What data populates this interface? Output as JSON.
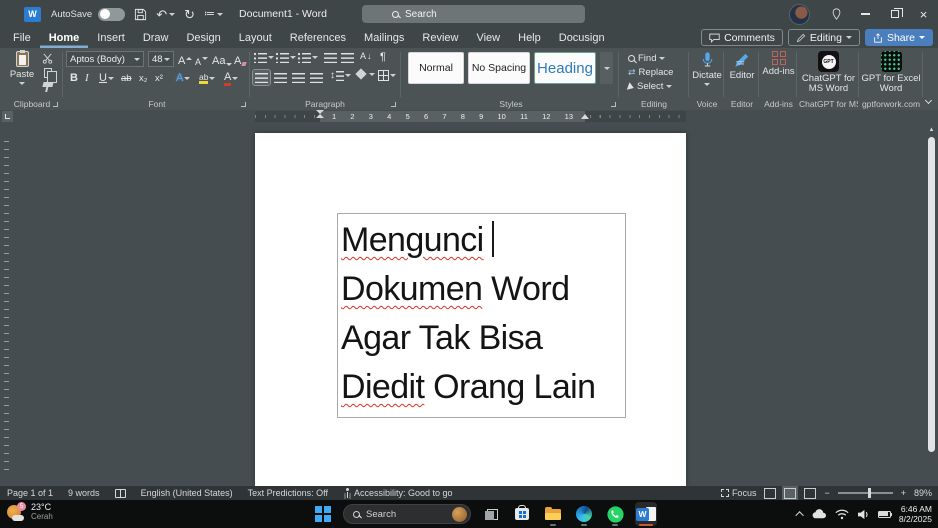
{
  "titlebar": {
    "autosave_label": "AutoSave",
    "autosave_state": "off",
    "document_title": "Document1  -  Word",
    "search_placeholder": "Search"
  },
  "tabs": {
    "items": [
      "File",
      "Home",
      "Insert",
      "Draw",
      "Design",
      "Layout",
      "References",
      "Mailings",
      "Review",
      "View",
      "Help",
      "Docusign"
    ],
    "active": "Home"
  },
  "actions": {
    "comments": "Comments",
    "editing": "Editing",
    "share": "Share"
  },
  "ribbon": {
    "clipboard": {
      "paste": "Paste",
      "group": "Clipboard"
    },
    "font": {
      "name": "Aptos (Body)",
      "size": "48",
      "bold": "B",
      "italic": "I",
      "underline": "U",
      "strike": "ab",
      "subscript": "x₂",
      "superscript": "x²",
      "grow": "A",
      "shrink": "A",
      "change_case": "Aa",
      "clear": "A",
      "effects": "A",
      "highlight": "ab",
      "color": "A",
      "group": "Font"
    },
    "paragraph": {
      "sort": "A",
      "pilcrow": "¶",
      "group": "Paragraph"
    },
    "styles": {
      "items": [
        "Normal",
        "No Spacing",
        "Heading"
      ],
      "group": "Styles"
    },
    "editing": {
      "find": "Find",
      "replace": "Replace",
      "select": "Select",
      "group": "Editing"
    },
    "voice": {
      "dictate": "Dictate",
      "group": "Voice"
    },
    "editor": {
      "label": "Editor",
      "group": "Editor"
    },
    "addins": {
      "label": "Add-ins",
      "group": "Add-ins"
    },
    "chatgpt": {
      "icon_text": "GPT",
      "label": "ChatGPT for MS Word",
      "group": "ChatGPT for MS Word"
    },
    "gptexcel": {
      "label": "GPT for Excel Word",
      "group": "gptforwork.com"
    }
  },
  "ruler": {
    "numbers": [
      "1",
      "2",
      "3",
      "4",
      "5",
      "6",
      "7",
      "8",
      "9",
      "10",
      "11",
      "12",
      "13"
    ]
  },
  "document": {
    "lines": [
      {
        "segments": [
          {
            "text": "Mengunci",
            "misspelled": true
          }
        ]
      },
      {
        "segments": [
          {
            "text": "Dokumen",
            "misspelled": true
          },
          {
            "text": " Word",
            "misspelled": false
          }
        ]
      },
      {
        "segments": [
          {
            "text": "Agar Tak Bisa",
            "misspelled": false
          }
        ]
      },
      {
        "segments": [
          {
            "text": "Diedit",
            "misspelled": true
          },
          {
            "text": " Orang Lain",
            "misspelled": false
          }
        ]
      }
    ]
  },
  "statusbar": {
    "page": "Page 1 of 1",
    "words": "9 words",
    "language": "English (United States)",
    "predictions": "Text Predictions: Off",
    "accessibility": "Accessibility: Good to go",
    "focus": "Focus",
    "zoom_minus": "−",
    "zoom_plus": "+",
    "zoom_level": "89%"
  },
  "taskbar": {
    "weather_temp": "23°C",
    "weather_condition": "Cerah",
    "weather_badge": "5",
    "search_placeholder": "Search",
    "time": "6:46 AM",
    "date": "8/2/2025"
  },
  "colors": {
    "share_button": "#4a7ebd",
    "heading_style_text": "#2f7ab8",
    "squiggly": "#d93025",
    "word_blue": "#2b7cd3",
    "taskbar_active_indicator": "#c75b39"
  }
}
